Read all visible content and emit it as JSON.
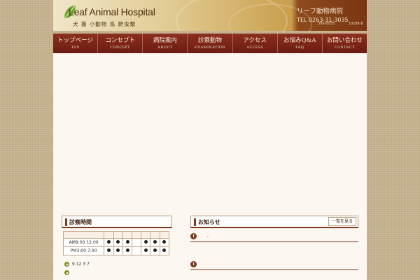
{
  "header": {
    "title": "Leaf Animal Hospital",
    "subtitle": "犬 猫 小動物 鳥 爬虫類",
    "name_jp": "リーフ動物病院",
    "tel": "TEL 0263-31-3035",
    "small_left": "399-0035",
    "small_right": "10289-8"
  },
  "nav": [
    {
      "jp": "トップページ",
      "en": "TOP"
    },
    {
      "jp": "コンセプト",
      "en": "CONCEPT"
    },
    {
      "jp": "病院案内",
      "en": "ABOUT"
    },
    {
      "jp": "診察動物",
      "en": "EXAMINATION"
    },
    {
      "jp": "アクセス",
      "en": "ACCESS"
    },
    {
      "jp": "お悩みQ&A",
      "en": "FAQ"
    },
    {
      "jp": "お問い合わせ",
      "en": "CONTACT"
    }
  ],
  "hours": {
    "title": "診察時間",
    "rows": [
      {
        "label": "AM9:00 12:00",
        "dots": [
          true,
          true,
          true,
          false,
          true,
          true,
          true
        ]
      },
      {
        "label": "PM3:00 7:00",
        "dots": [
          true,
          true,
          true,
          false,
          true,
          true,
          true
        ]
      }
    ],
    "note1": "9 12 3 7",
    "note2": ""
  },
  "news": {
    "title": "お知らせ",
    "more_label": "一覧を見る",
    "items": [
      {
        "text": ","
      },
      {
        "text": ""
      }
    ]
  },
  "colors": {
    "nav_bg": "#7a2416",
    "accent": "#7a3a1c",
    "page_bg": "#cdb794",
    "content_bg": "#fcf7f0"
  }
}
